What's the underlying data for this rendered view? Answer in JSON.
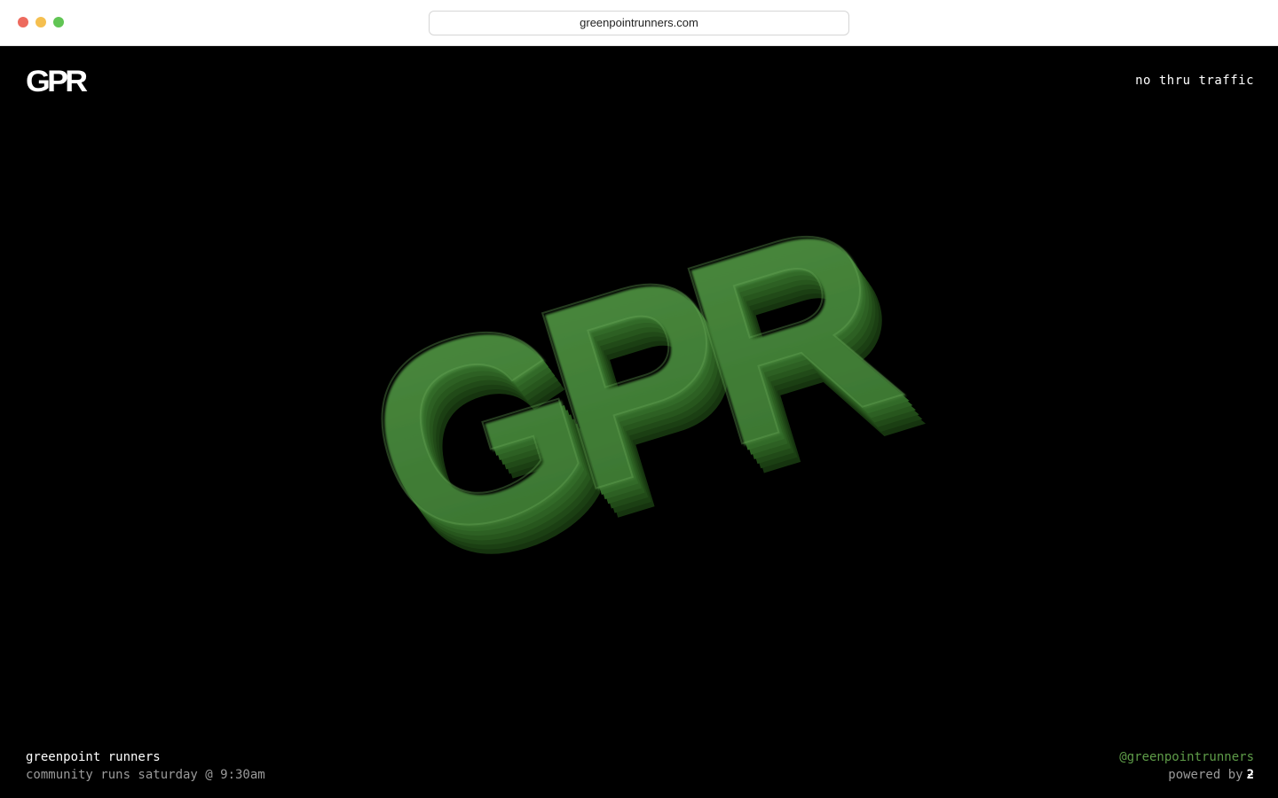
{
  "browser": {
    "url": "greenpointrunners.com"
  },
  "header": {
    "logo_text": "GPR",
    "tagline": "no thru traffic"
  },
  "hero": {
    "text": "GPR",
    "color": "#3e7a33"
  },
  "footer": {
    "name": "greenpoint runners",
    "schedule": "community runs saturday @ 9:30am",
    "handle": "@greenpointrunners",
    "powered_by_label": "powered by",
    "powered_by_mark": "ƻ"
  },
  "colors": {
    "background": "#000000",
    "accent_green": "#5e9c48",
    "muted_text": "#9a9a9a"
  }
}
